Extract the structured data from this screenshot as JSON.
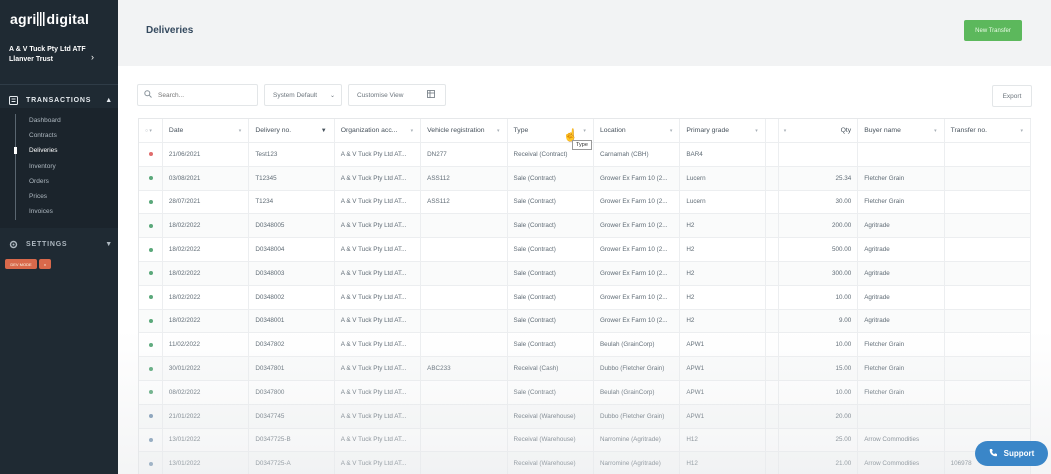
{
  "brand": {
    "logo_left": "agri",
    "logo_right": "digital"
  },
  "sidebar": {
    "org_name": "A & V Tuck Pty Ltd ATF Llanver Trust",
    "transactions_label": "TRANSACTIONS",
    "settings_label": "SETTINGS",
    "items": [
      {
        "label": "Dashboard"
      },
      {
        "label": "Contracts"
      },
      {
        "label": "Deliveries",
        "active": true
      },
      {
        "label": "Inventory"
      },
      {
        "label": "Orders"
      },
      {
        "label": "Prices"
      },
      {
        "label": "Invoices"
      }
    ]
  },
  "header": {
    "title": "Deliveries",
    "new_button": "New Transfer"
  },
  "toolbar": {
    "search_placeholder": "Search...",
    "view_select": "System Default",
    "customise_label": "Customise View",
    "export_label": "Export"
  },
  "table": {
    "columns": [
      "Date",
      "Delivery no.",
      "Organization acc...",
      "Vehicle registration",
      "Type",
      "Location",
      "Primary grade",
      "",
      "Qty",
      "Buyer name",
      "Transfer no."
    ],
    "rows": [
      {
        "status": "red",
        "cells": [
          "21/06/2021",
          "Test123",
          "A & V Tuck Pty Ltd AT...",
          "DN277",
          "Receival (Contract)",
          "Carnamah (CBH)",
          "BAR4",
          "",
          "",
          "",
          ""
        ]
      },
      {
        "status": "green",
        "cells": [
          "03/08/2021",
          "T12345",
          "A & V Tuck Pty Ltd AT...",
          "ASS112",
          "Sale (Contract)",
          "Grower Ex Farm 10 (2...",
          "Lucern",
          "",
          "25.34",
          "Fletcher Grain",
          ""
        ]
      },
      {
        "status": "green",
        "cells": [
          "28/07/2021",
          "T1234",
          "A & V Tuck Pty Ltd AT...",
          "ASS112",
          "Sale (Contract)",
          "Grower Ex Farm 10 (2...",
          "Lucern",
          "",
          "30.00",
          "Fletcher Grain",
          ""
        ]
      },
      {
        "status": "green",
        "cells": [
          "18/02/2022",
          "D0348005",
          "A & V Tuck Pty Ltd AT...",
          "",
          "Sale (Contract)",
          "Grower Ex Farm 10 (2...",
          "H2",
          "",
          "200.00",
          "Agritrade",
          ""
        ]
      },
      {
        "status": "green",
        "cells": [
          "18/02/2022",
          "D0348004",
          "A & V Tuck Pty Ltd AT...",
          "",
          "Sale (Contract)",
          "Grower Ex Farm 10 (2...",
          "H2",
          "",
          "500.00",
          "Agritrade",
          ""
        ]
      },
      {
        "status": "green",
        "cells": [
          "18/02/2022",
          "D0348003",
          "A & V Tuck Pty Ltd AT...",
          "",
          "Sale (Contract)",
          "Grower Ex Farm 10 (2...",
          "H2",
          "",
          "300.00",
          "Agritrade",
          ""
        ]
      },
      {
        "status": "green",
        "cells": [
          "18/02/2022",
          "D0348002",
          "A & V Tuck Pty Ltd AT...",
          "",
          "Sale (Contract)",
          "Grower Ex Farm 10 (2...",
          "H2",
          "",
          "10.00",
          "Agritrade",
          ""
        ]
      },
      {
        "status": "green",
        "cells": [
          "18/02/2022",
          "D0348001",
          "A & V Tuck Pty Ltd AT...",
          "",
          "Sale (Contract)",
          "Grower Ex Farm 10 (2...",
          "H2",
          "",
          "9.00",
          "Agritrade",
          ""
        ]
      },
      {
        "status": "green",
        "cells": [
          "11/02/2022",
          "D0347802",
          "A & V Tuck Pty Ltd AT...",
          "",
          "Sale (Contract)",
          "Beulah (GrainCorp)",
          "APW1",
          "",
          "10.00",
          "Fletcher Grain",
          ""
        ]
      },
      {
        "status": "green",
        "cells": [
          "30/01/2022",
          "D0347801",
          "A & V Tuck Pty Ltd AT...",
          "ABC233",
          "Receival (Cash)",
          "Dubbo (Fletcher Grain)",
          "APW1",
          "",
          "15.00",
          "Fletcher Grain",
          ""
        ]
      },
      {
        "status": "green",
        "cells": [
          "08/02/2022",
          "D0347800",
          "A & V Tuck Pty Ltd AT...",
          "",
          "Sale (Contract)",
          "Beulah (GrainCorp)",
          "APW1",
          "",
          "10.00",
          "Fletcher Grain",
          ""
        ]
      },
      {
        "status": "blue",
        "cells": [
          "21/01/2022",
          "D0347745",
          "A & V Tuck Pty Ltd AT...",
          "",
          "Receival (Warehouse)",
          "Dubbo (Fletcher Grain)",
          "APW1",
          "",
          "20.00",
          "",
          ""
        ]
      },
      {
        "status": "blue",
        "cells": [
          "13/01/2022",
          "D0347725-B",
          "A & V Tuck Pty Ltd AT...",
          "",
          "Receival (Warehouse)",
          "Narromine (Agritrade)",
          "H12",
          "",
          "25.00",
          "Arrow Commodities",
          ""
        ]
      },
      {
        "status": "blue",
        "cells": [
          "13/01/2022",
          "D0347725-A",
          "A & V Tuck Pty Ltd AT...",
          "",
          "Receival (Warehouse)",
          "Narromine (Agritrade)",
          "H12",
          "",
          "21.00",
          "Arrow Commodities",
          "106978"
        ]
      }
    ]
  },
  "tooltip": "Type",
  "support_label": "Support",
  "colors": {
    "sidebar": "#1f2a33",
    "primary_green": "#5cb85c",
    "support_blue": "#3a86c8",
    "status_red": "#e06c6c",
    "status_green": "#5aa87a",
    "status_blue": "#6f8fae"
  },
  "dev_tags": [
    "DEV MODE",
    "v"
  ]
}
